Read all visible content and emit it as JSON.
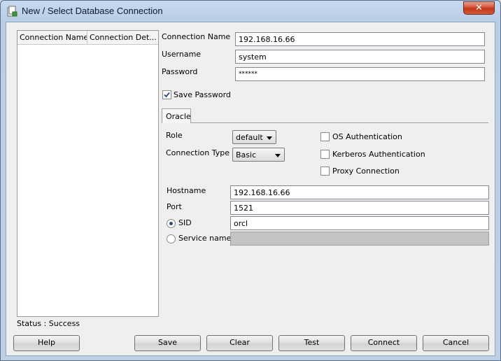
{
  "window": {
    "title": "New / Select Database Connection",
    "close_glyph": "✕"
  },
  "list": {
    "columns": [
      "Connection Name",
      "Connection Det..."
    ]
  },
  "form": {
    "connection_name": {
      "label": "Connection Name",
      "value": "192.168.16.66"
    },
    "username": {
      "label": "Username",
      "value": "system"
    },
    "password": {
      "label": "Password",
      "value": "******"
    },
    "save_password": {
      "label": "Save Password",
      "checked": true
    }
  },
  "tabs": [
    {
      "label": "Oracle"
    }
  ],
  "oracle": {
    "role": {
      "label": "Role",
      "value": "default"
    },
    "connection_type": {
      "label": "Connection Type",
      "value": "Basic"
    },
    "os_auth": {
      "label": "OS Authentication",
      "checked": false
    },
    "kerberos_auth": {
      "label": "Kerberos Authentication",
      "checked": false
    },
    "proxy_connection": {
      "label": "Proxy Connection",
      "checked": false
    },
    "hostname": {
      "label": "Hostname",
      "value": "192.168.16.66"
    },
    "port": {
      "label": "Port",
      "value": "1521"
    },
    "sid": {
      "label": "SID",
      "value": "orcl",
      "selected": true
    },
    "service_name": {
      "label": "Service name",
      "value": "",
      "selected": false
    }
  },
  "status": "Status : Success",
  "buttons": {
    "help": "Help",
    "save": "Save",
    "clear": "Clear",
    "test": "Test",
    "connect": "Connect",
    "cancel": "Cancel"
  },
  "icons": {
    "app": "database-connection-icon",
    "check": "check-icon"
  },
  "colors": {
    "titlebar": "#c8d9ee",
    "close_button": "#c13515",
    "dialog_background": "#efefef",
    "radio_dot": "#2a4b7c"
  }
}
